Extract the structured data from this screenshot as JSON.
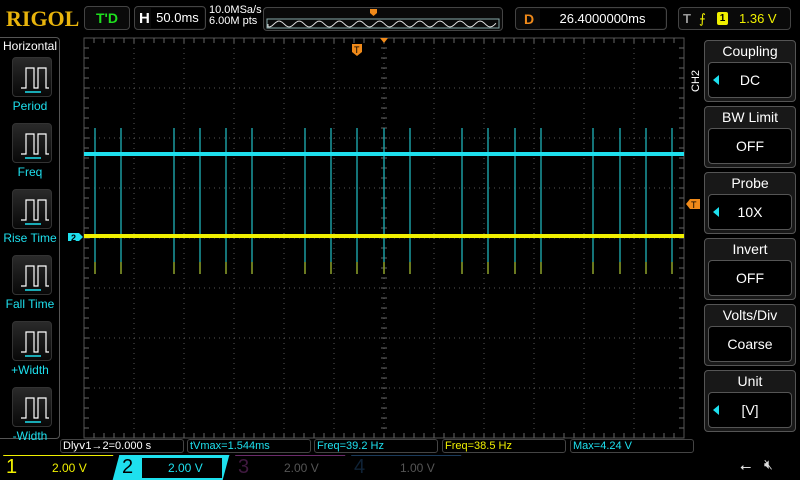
{
  "header": {
    "logo": "RIGOL",
    "trigger_status": "T'D",
    "h_label": "H",
    "timebase": "50.0ms",
    "sample_rate": "10.0MSa/s",
    "memory_depth": "6.00M pts",
    "delay_label": "D",
    "delay": "26.4000000ms",
    "trigger_label": "T",
    "trigger_source": "1",
    "trigger_level": "1.36 V"
  },
  "left_menu": {
    "title": "Horizontal",
    "items": [
      {
        "label": "Period",
        "icon": "period-icon"
      },
      {
        "label": "Freq",
        "icon": "freq-icon"
      },
      {
        "label": "Rise Time",
        "icon": "rise-time-icon"
      },
      {
        "label": "Fall Time",
        "icon": "fall-time-icon"
      },
      {
        "label": "+Width",
        "icon": "pos-width-icon"
      },
      {
        "label": "-Width",
        "icon": "neg-width-icon"
      }
    ]
  },
  "right_menu": {
    "channel": "CH2",
    "items": [
      {
        "title": "Coupling",
        "value": "DC"
      },
      {
        "title": "BW Limit",
        "value": "OFF"
      },
      {
        "title": "Probe",
        "value": "10X"
      },
      {
        "title": "Invert",
        "value": "OFF"
      },
      {
        "title": "Volts/Div",
        "value": "Coarse"
      },
      {
        "title": "Unit",
        "value": "[V]"
      }
    ]
  },
  "measurements": [
    {
      "text": "Dlyⅴ1→2=0.000 s"
    },
    {
      "text": "tVmax=1.544ms"
    },
    {
      "text": "Freq=39.2 Hz"
    },
    {
      "text": "Freq=38.5 Hz"
    },
    {
      "text": "Max=4.24 V"
    }
  ],
  "channels": [
    {
      "num": "1",
      "scale": "2.00 V",
      "color": "#f0f000"
    },
    {
      "num": "2",
      "scale": "2.00 V",
      "color": "#1ee0ee"
    },
    {
      "num": "3",
      "scale": "2.00 V",
      "color": "#6a2a6a"
    },
    {
      "num": "4",
      "scale": "1.00 V",
      "color": "#1a3a5a"
    }
  ],
  "markers": {
    "ch2": "2",
    "trigger": "T"
  },
  "colors": {
    "ch1": "#f0f000",
    "ch2": "#1ee0ee",
    "trigger": "#f08a1a"
  }
}
